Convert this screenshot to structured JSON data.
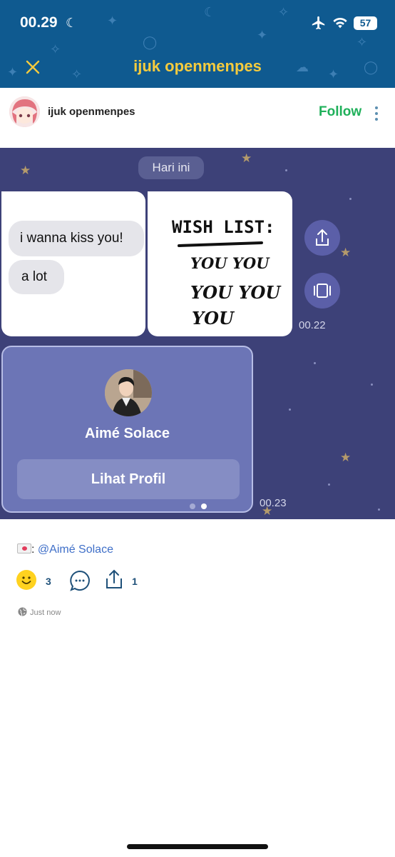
{
  "status_bar": {
    "time": "00.29",
    "battery": "57"
  },
  "header": {
    "title": "ijuk openmenpes"
  },
  "author": {
    "name": "ijuk openmenpes",
    "follow_label": "Follow"
  },
  "chat": {
    "date_label": "Hari ini",
    "messages": [
      "i wanna kiss you!",
      "a lot"
    ],
    "wishlist": {
      "title": "WISH LIST:",
      "lines": [
        "YOU YOU",
        "YOU YOU",
        "YOU"
      ]
    },
    "time_1": "00.22",
    "profile_name": "Aimé Solace",
    "profile_button": "Lihat Profil",
    "time_2": "00.23"
  },
  "caption": {
    "separator": ":",
    "mention": "@Aimé Solace"
  },
  "actions": {
    "reactions": "3",
    "shares": "1"
  },
  "meta": {
    "posted": "Just now"
  },
  "colors": {
    "header_bg": "#0f5a90",
    "title": "#f5cb3e",
    "follow": "#1fb05a",
    "chat_bg": "#3d4178",
    "mention": "#3f6fc8"
  }
}
